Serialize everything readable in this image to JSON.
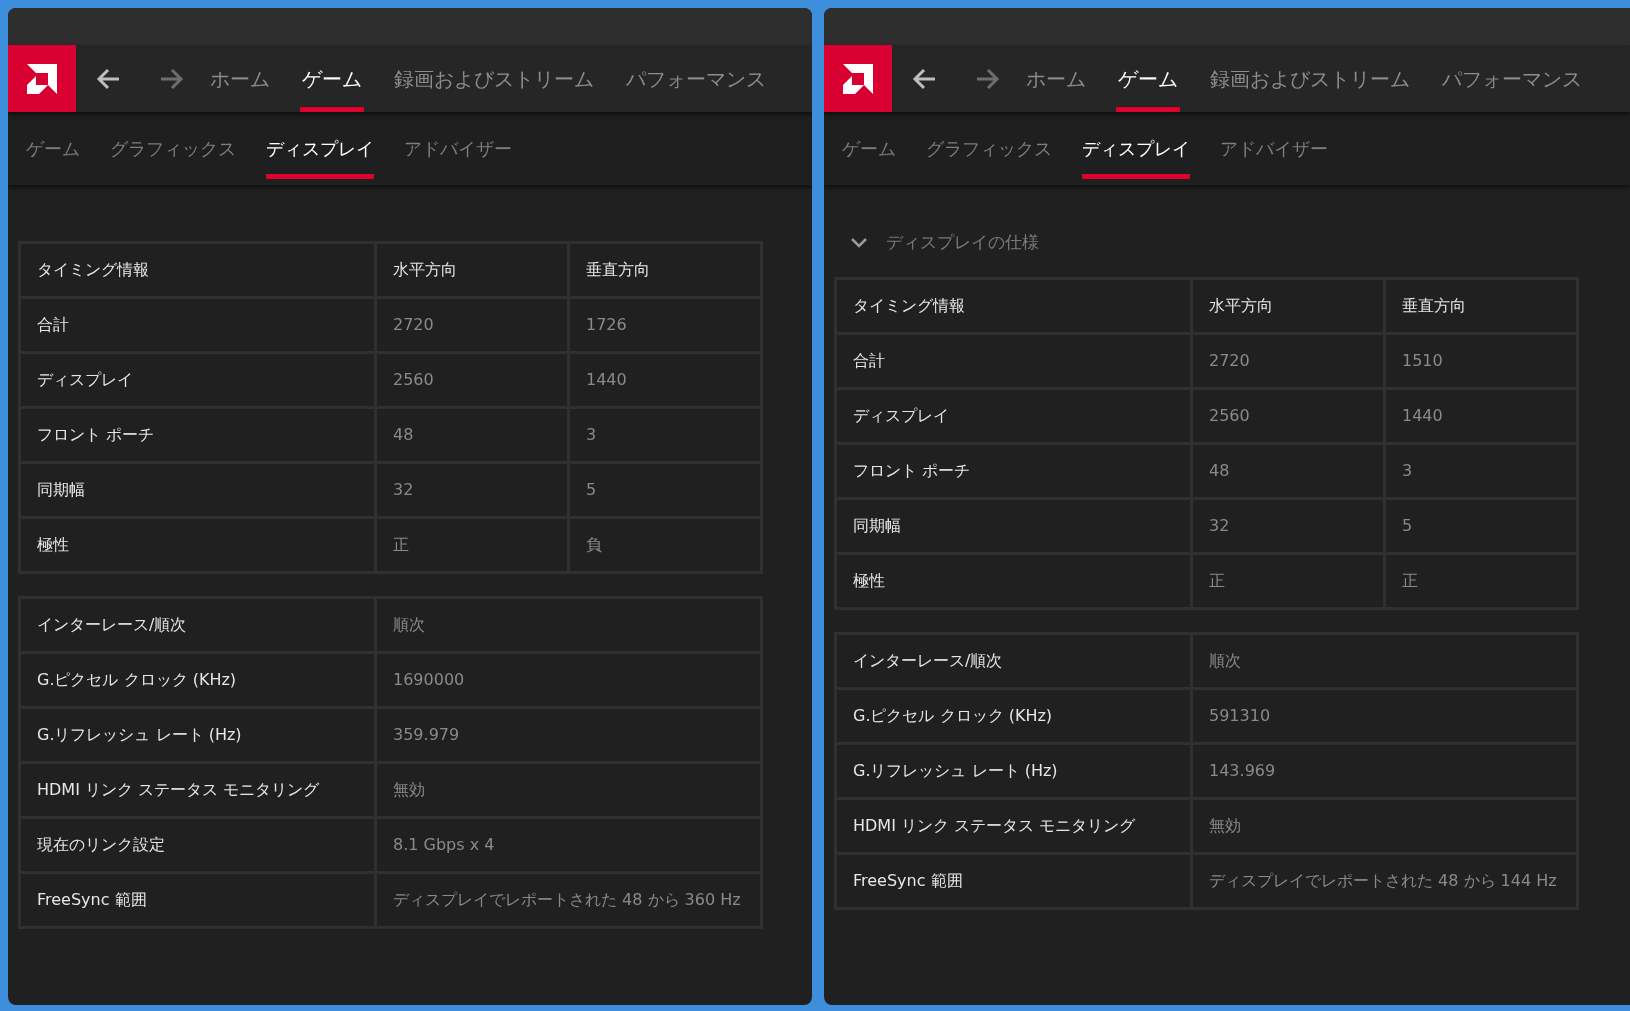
{
  "windows": [
    {
      "nav": [
        {
          "label": "ホーム",
          "selected": false
        },
        {
          "label": "ゲーム",
          "selected": true
        },
        {
          "label": "録画およびストリーム",
          "selected": false
        },
        {
          "label": "パフォーマンス",
          "selected": false
        }
      ],
      "subtabs": [
        {
          "label": "ゲーム",
          "selected": false
        },
        {
          "label": "グラフィックス",
          "selected": false
        },
        {
          "label": "ディスプレイ",
          "selected": true
        },
        {
          "label": "アドバイザー",
          "selected": false
        }
      ],
      "timing_table": {
        "columns": [
          "タイミング情報",
          "水平方向",
          "垂直方向"
        ],
        "rows": [
          [
            "合計",
            "2720",
            "1726"
          ],
          [
            "ディスプレイ",
            "2560",
            "1440"
          ],
          [
            "フロント ポーチ",
            "48",
            "3"
          ],
          [
            "同期幅",
            "32",
            "5"
          ],
          [
            "極性",
            "正",
            "負"
          ]
        ]
      },
      "info_table": {
        "rows": [
          [
            "インターレース/順次",
            "順次"
          ],
          [
            "G.ピクセル クロック (KHz)",
            "1690000"
          ],
          [
            "G.リフレッシュ レート (Hz)",
            "359.979"
          ],
          [
            "HDMI リンク ステータス モニタリング",
            "無効"
          ],
          [
            "現在のリンク設定",
            "8.1 Gbps x 4"
          ],
          [
            "FreeSync 範囲",
            "ディスプレイでレポートされた 48 から 360 Hz"
          ]
        ]
      }
    },
    {
      "nav": [
        {
          "label": "ホーム",
          "selected": false
        },
        {
          "label": "ゲーム",
          "selected": true
        },
        {
          "label": "録画およびストリーム",
          "selected": false
        },
        {
          "label": "パフォーマンス",
          "selected": false
        }
      ],
      "subtabs": [
        {
          "label": "ゲーム",
          "selected": false
        },
        {
          "label": "グラフィックス",
          "selected": false
        },
        {
          "label": "ディスプレイ",
          "selected": true
        },
        {
          "label": "アドバイザー",
          "selected": false
        }
      ],
      "section": {
        "title": "ディスプレイの仕様",
        "expanded": true
      },
      "timing_table": {
        "columns": [
          "タイミング情報",
          "水平方向",
          "垂直方向"
        ],
        "rows": [
          [
            "合計",
            "2720",
            "1510"
          ],
          [
            "ディスプレイ",
            "2560",
            "1440"
          ],
          [
            "フロント ポーチ",
            "48",
            "3"
          ],
          [
            "同期幅",
            "32",
            "5"
          ],
          [
            "極性",
            "正",
            "正"
          ]
        ]
      },
      "info_table": {
        "rows": [
          [
            "インターレース/順次",
            "順次"
          ],
          [
            "G.ピクセル クロック (KHz)",
            "591310"
          ],
          [
            "G.リフレッシュ レート (Hz)",
            "143.969"
          ],
          [
            "HDMI リンク ステータス モニタリング",
            "無効"
          ],
          [
            "FreeSync 範囲",
            "ディスプレイでレポートされた 48 から 144 Hz"
          ]
        ]
      }
    }
  ]
}
